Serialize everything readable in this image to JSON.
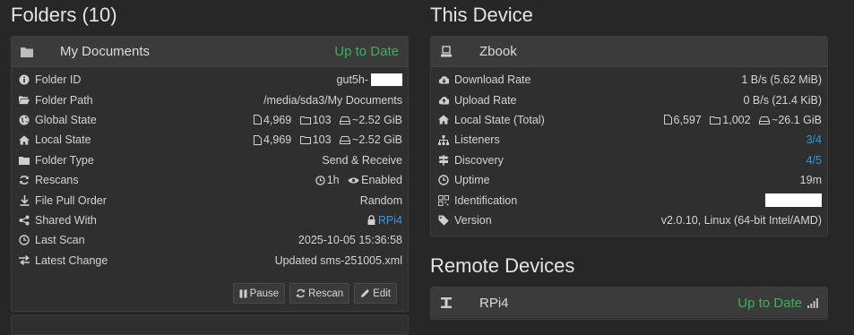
{
  "folders": {
    "heading": "Folders (10)",
    "panel": {
      "name": "My Documents",
      "status": "Up to Date",
      "rows": [
        {
          "label": "Folder ID",
          "value": "gut5h-"
        },
        {
          "label": "Folder Path",
          "value": "/media/sda3/My Documents"
        },
        {
          "label": "Global State",
          "files": "4,969",
          "dirs": "103",
          "size": "~2.52 GiB"
        },
        {
          "label": "Local State",
          "files": "4,969",
          "dirs": "103",
          "size": "~2.52 GiB"
        },
        {
          "label": "Folder Type",
          "value": "Send & Receive"
        },
        {
          "label": "Rescans",
          "interval": "1h",
          "watch": "Enabled"
        },
        {
          "label": "File Pull Order",
          "value": "Random"
        },
        {
          "label": "Shared With",
          "value": "RPi4"
        },
        {
          "label": "Last Scan",
          "value": "2025-10-05 15:36:58"
        },
        {
          "label": "Latest Change",
          "value": "Updated sms-251005.xml"
        }
      ],
      "buttons": {
        "pause": "Pause",
        "rescan": "Rescan",
        "edit": "Edit"
      }
    }
  },
  "this_device": {
    "heading": "This Device",
    "name": "Zbook",
    "rows": [
      {
        "label": "Download Rate",
        "value": "1 B/s (5.62 MiB)"
      },
      {
        "label": "Upload Rate",
        "value": "0 B/s (21.4 KiB)"
      },
      {
        "label": "Local State (Total)",
        "files": "6,597",
        "dirs": "1,002",
        "size": "~26.1 GiB"
      },
      {
        "label": "Listeners",
        "value": "3/4"
      },
      {
        "label": "Discovery",
        "value": "4/5"
      },
      {
        "label": "Uptime",
        "value": "19m"
      },
      {
        "label": "Identification",
        "value": ""
      },
      {
        "label": "Version",
        "value": "v2.0.10, Linux (64-bit Intel/AMD)"
      }
    ]
  },
  "remote_devices": {
    "heading": "Remote Devices",
    "devices": [
      {
        "name": "RPi4",
        "status": "Up to Date"
      }
    ]
  },
  "colors": {
    "ok": "#3cb35a",
    "link": "#2f9be0"
  }
}
